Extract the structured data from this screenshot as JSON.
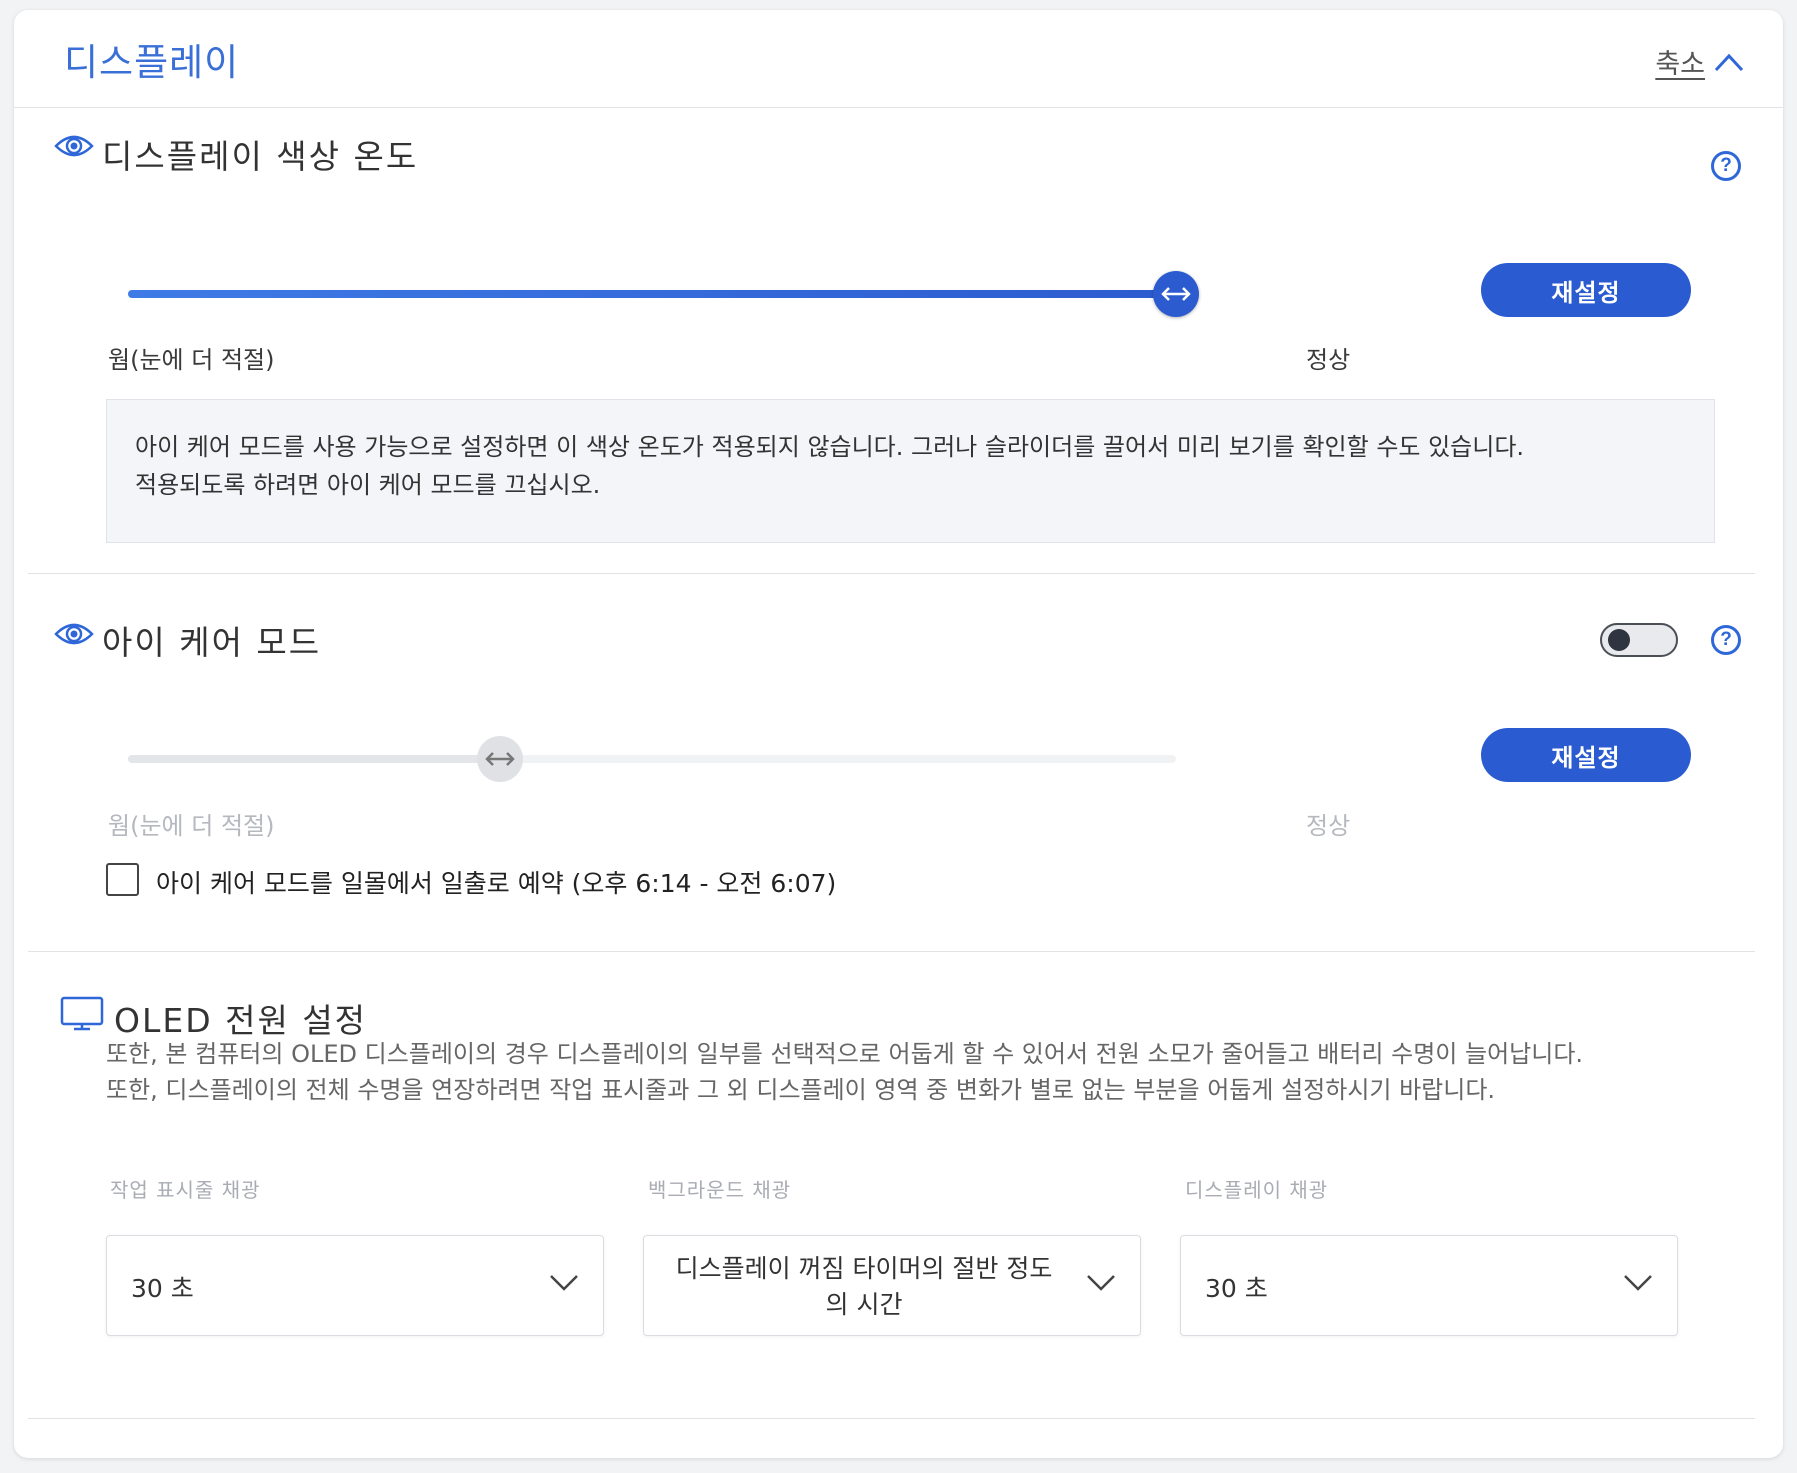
{
  "header": {
    "title": "디스플레이",
    "collapse_label": "축소"
  },
  "color_temp": {
    "title": "디스플레이 색상 온도",
    "slider_value": 1.0,
    "label_left": "웜(눈에 더 적절)",
    "label_right": "정상",
    "reset_label": "재설정",
    "info_line1": "아이 케어 모드를 사용 가능으로 설정하면 이 색상 온도가 적용되지 않습니다. 그러나 슬라이더를 끌어서 미리 보기를 확인할 수도 있습니다.",
    "info_line2": "적용되도록 하려면 아이 케어 모드를 끄십시오."
  },
  "eye_care": {
    "title": "아이 케어 모드",
    "enabled": false,
    "slider_value": 0.355,
    "label_left": "웜(눈에 더 적절)",
    "label_right": "정상",
    "reset_label": "재설정",
    "schedule_label": "아이 케어 모드를 일몰에서 일출로 예약 (오후 6:14 - 오전 6:07)",
    "schedule_checked": false
  },
  "oled": {
    "title": "OLED 전원 설정",
    "desc_line1": "또한, 본 컴퓨터의 OLED 디스플레이의 경우 디스플레이의 일부를 선택적으로 어둡게 할 수 있어서 전원 소모가 줄어들고 배터리 수명이 늘어납니다.",
    "desc_line2": "또한, 디스플레이의 전체 수명을 연장하려면 작업 표시줄과 그 외 디스플레이 영역 중 변화가 별로 없는 부분을 어둡게 설정하시기 바랍니다.",
    "dropdowns": [
      {
        "label": "작업 표시줄 채광",
        "value": "30 초"
      },
      {
        "label": "백그라운드 채광",
        "value_line1": "디스플레이 꺼짐 타이머의 절반 정도",
        "value_line2": "의 시간"
      },
      {
        "label": "디스플레이 채광",
        "value": "30 초"
      }
    ]
  },
  "colors": {
    "accent": "#2a5bd1",
    "title_blue": "#3a6fd8"
  }
}
